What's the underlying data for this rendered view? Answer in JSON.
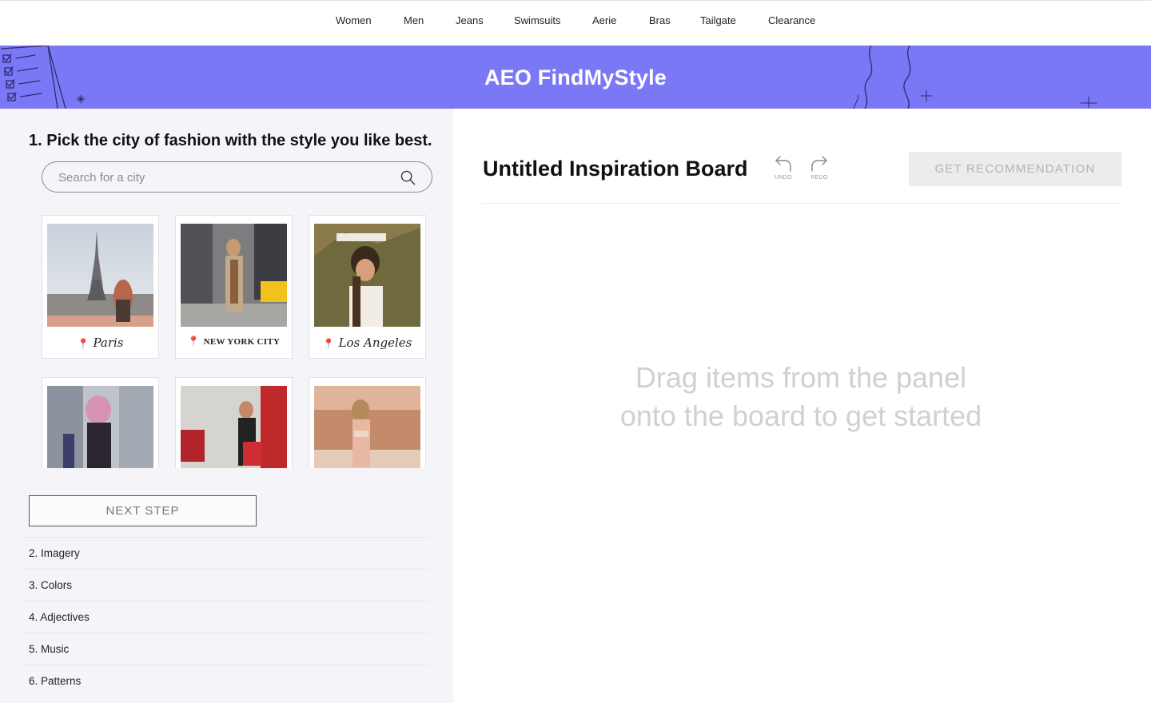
{
  "nav": {
    "items": [
      "Women",
      "Men",
      "Jeans",
      "Swimsuits",
      "Aerie",
      "Bras",
      "Tailgate",
      "Clearance"
    ]
  },
  "banner": {
    "title": "AEO FindMyStyle",
    "color": "#7b78f5"
  },
  "left_panel": {
    "step_title": "1. Pick the city of fashion with the style you like best.",
    "search": {
      "placeholder": "Search for a city",
      "value": "",
      "icon": "search-icon"
    },
    "cities": [
      {
        "name": "Paris",
        "label_style": "script"
      },
      {
        "name": "NEW YORK CITY",
        "label_style": "caps"
      },
      {
        "name": "Los Angeles",
        "label_style": "script"
      },
      {
        "name": "",
        "label_style": "none"
      },
      {
        "name": "",
        "label_style": "none"
      },
      {
        "name": "",
        "label_style": "none"
      }
    ],
    "next_button": "NEXT STEP",
    "steps": [
      "2. Imagery",
      "3. Colors",
      "4. Adjectives",
      "5. Music",
      "6. Patterns"
    ]
  },
  "board": {
    "title": "Untitled Inspiration Board",
    "undo_label": "UNDO",
    "redo_label": "REDO",
    "recommend_button": "GET RECOMMENDATION",
    "empty_message_line1": "Drag items from the panel",
    "empty_message_line2": "onto the board to get started"
  }
}
